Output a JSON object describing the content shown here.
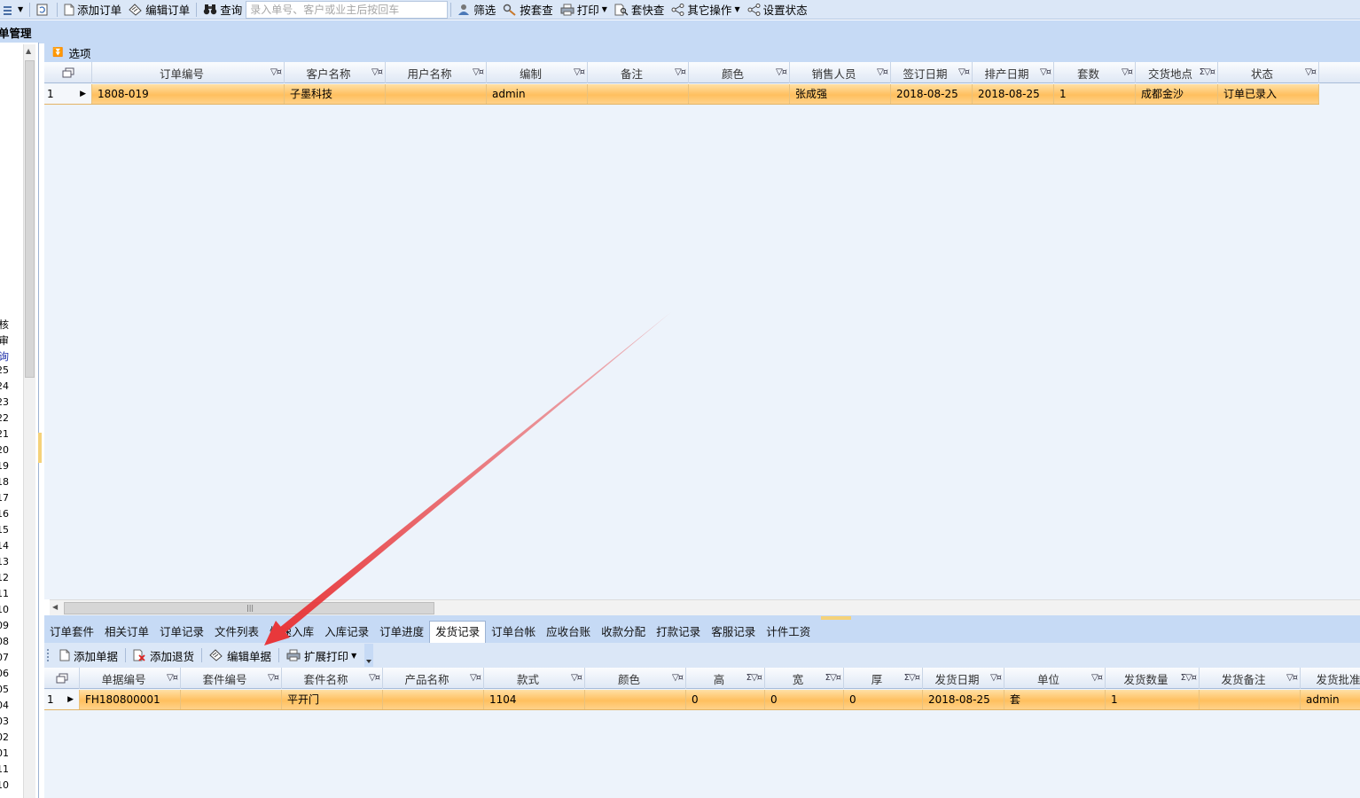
{
  "toolbar": {
    "add_order": "添加订单",
    "edit_order": "编辑订单",
    "query": "查询",
    "search_placeholder": "录入单号、客户或业主后按回车",
    "filter": "筛选",
    "by_set_check": "按套查",
    "print": "打印",
    "quick_check": "套快查",
    "other_ops": "其它操作",
    "set_status": "设置状态"
  },
  "left_panel": {
    "title": "单管理",
    "labels": [
      "核",
      "审",
      "询"
    ],
    "numbers": [
      "25",
      "24",
      "23",
      "22",
      "21",
      "20",
      "19",
      "18",
      "17",
      "16",
      "15",
      "14",
      "13",
      "12",
      "11",
      "10",
      "09",
      "08",
      "07",
      "06",
      "05",
      "04",
      "03",
      "02",
      "01",
      "11",
      "10"
    ]
  },
  "options_bar": {
    "label": "选项"
  },
  "orders_grid": {
    "columns": [
      "订单编号",
      "客户名称",
      "用户名称",
      "编制",
      "备注",
      "颜色",
      "销售人员",
      "签订日期",
      "排产日期",
      "套数",
      "交货地点",
      "状态"
    ],
    "rows": [
      {
        "index": "1",
        "cells": [
          "1808-019",
          "子墨科技",
          "",
          "admin",
          "",
          "",
          "张成强",
          "2018-08-25",
          "2018-08-25",
          "1",
          "成都金沙",
          "订单已录入"
        ]
      }
    ]
  },
  "tabs": [
    "订单套件",
    "相关订单",
    "订单记录",
    "文件列表",
    "快速入库",
    "入库记录",
    "订单进度",
    "发货记录",
    "订单台帐",
    "应收台账",
    "收款分配",
    "打款记录",
    "客服记录",
    "计件工资"
  ],
  "active_tab": "发货记录",
  "sub_toolbar": {
    "add_doc": "添加单据",
    "add_return": "添加退货",
    "edit_doc": "编辑单据",
    "ext_print": "扩展打印"
  },
  "shipping_grid": {
    "columns": [
      "单据编号",
      "套件编号",
      "套件名称",
      "产品名称",
      "款式",
      "颜色",
      "高",
      "宽",
      "厚",
      "发货日期",
      "单位",
      "发货数量",
      "发货备注",
      "发货批准"
    ],
    "rows": [
      {
        "index": "1",
        "cells": [
          "FH180800001",
          "",
          "平开门",
          "",
          "1104",
          "",
          "0",
          "0",
          "0",
          "2018-08-25",
          "套",
          "1",
          "",
          "admin"
        ]
      }
    ]
  },
  "colors": {
    "toolbar_bg": "#dbe7f7",
    "header_strip": "#c6daf5",
    "selected_row": "#ffbf5e",
    "annotation_arrow": "#e8383b"
  }
}
